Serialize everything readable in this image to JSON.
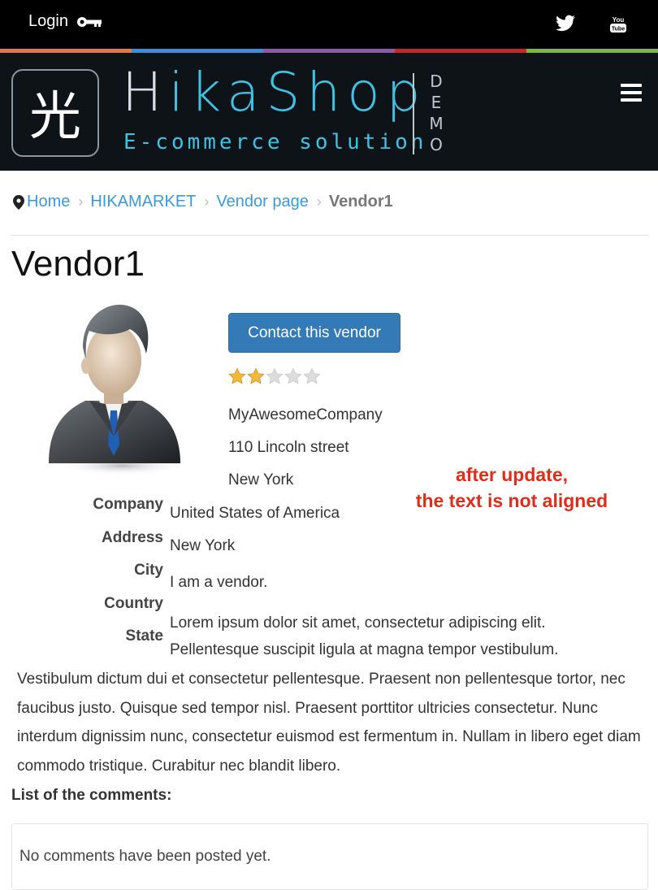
{
  "topbar": {
    "login_label": "Login",
    "login_icon": "key-icon",
    "social": [
      "twitter-icon",
      "youtube-icon"
    ],
    "youtube_text": [
      "You",
      "Tube"
    ]
  },
  "colors": {
    "strip": [
      "#e27b3f",
      "#3a8fd6",
      "#8c5aa3",
      "#c9262b",
      "#7db93a"
    ],
    "brand_accent": "#3ec3e5",
    "link": "#3a9ad9",
    "button": "#337ab7",
    "annotation": "#e02d1b"
  },
  "header": {
    "logo_glyph": "光",
    "brand_prefix": "H",
    "brand_rest": "ikaShop",
    "tagline": "E-commerce solution",
    "demo": "DEMO",
    "menu_icon": "hamburger-icon"
  },
  "breadcrumb": {
    "items": [
      "Home",
      "HIKAMARKET",
      "Vendor page"
    ],
    "current": "Vendor1"
  },
  "vendor": {
    "name": "Vendor1",
    "contact_button": "Contact this vendor",
    "rating": {
      "value": 2,
      "max": 5
    },
    "company": "MyAwesomeCompany",
    "street": "110 Lincoln street",
    "city": "New York",
    "country": "United States of America",
    "state": "New York",
    "intro": "I am a vendor.",
    "desc_line1": "Lorem ipsum dolor sit amet, consectetur adipiscing elit.",
    "desc_line2": "Pellentesque suscipit ligula at magna tempor vestibulum.",
    "desc_rest": "Vestibulum dictum dui et consectetur pellentesque. Praesent non pellentesque tortor, nec faucibus justo. Quisque sed tempor nisl. Praesent porttitor ultricies consectetur. Nunc interdum dignissim nunc, consectetur euismod est fermentum in. Nullam in libero eget diam commodo tristique. Curabitur nec blandit libero."
  },
  "labels": {
    "company": "Company",
    "address": "Address",
    "city": "City",
    "country": "Country",
    "state": "State"
  },
  "annotation": {
    "line1": "after update,",
    "line2": "the text is not aligned"
  },
  "comments": {
    "title": "List of the comments:",
    "empty": "No comments have been posted yet."
  }
}
